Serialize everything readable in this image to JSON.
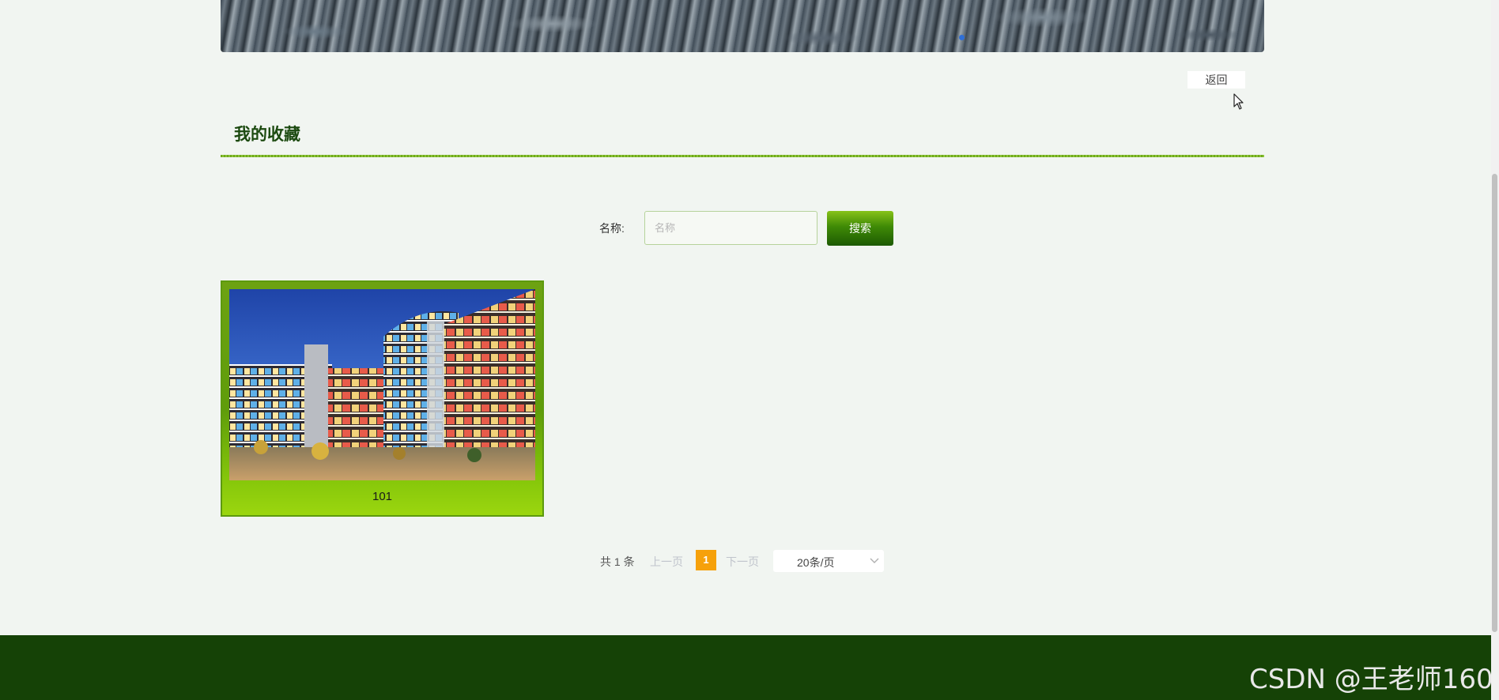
{
  "header": {
    "back_label": "返回"
  },
  "page": {
    "title": "我的收藏"
  },
  "search": {
    "label": "名称:",
    "placeholder": "名称",
    "value": "",
    "button_label": "搜索"
  },
  "favorites": [
    {
      "caption": "101",
      "image": "shopping-mall-night-photo"
    }
  ],
  "pagination": {
    "total_text": "共 1 条",
    "prev_label": "上一页",
    "current_page": "1",
    "next_label": "下一页",
    "page_size": "20条/页"
  },
  "watermark": "CSDN @王老师160",
  "colors": {
    "page_bg": "#f1f5f1",
    "title": "#1c4a10",
    "accent_green": "#3f8a06",
    "footer": "#154206",
    "page_current": "#f6a10b"
  },
  "icons": [
    "mouse-cursor-icon",
    "chevron-down-icon"
  ]
}
